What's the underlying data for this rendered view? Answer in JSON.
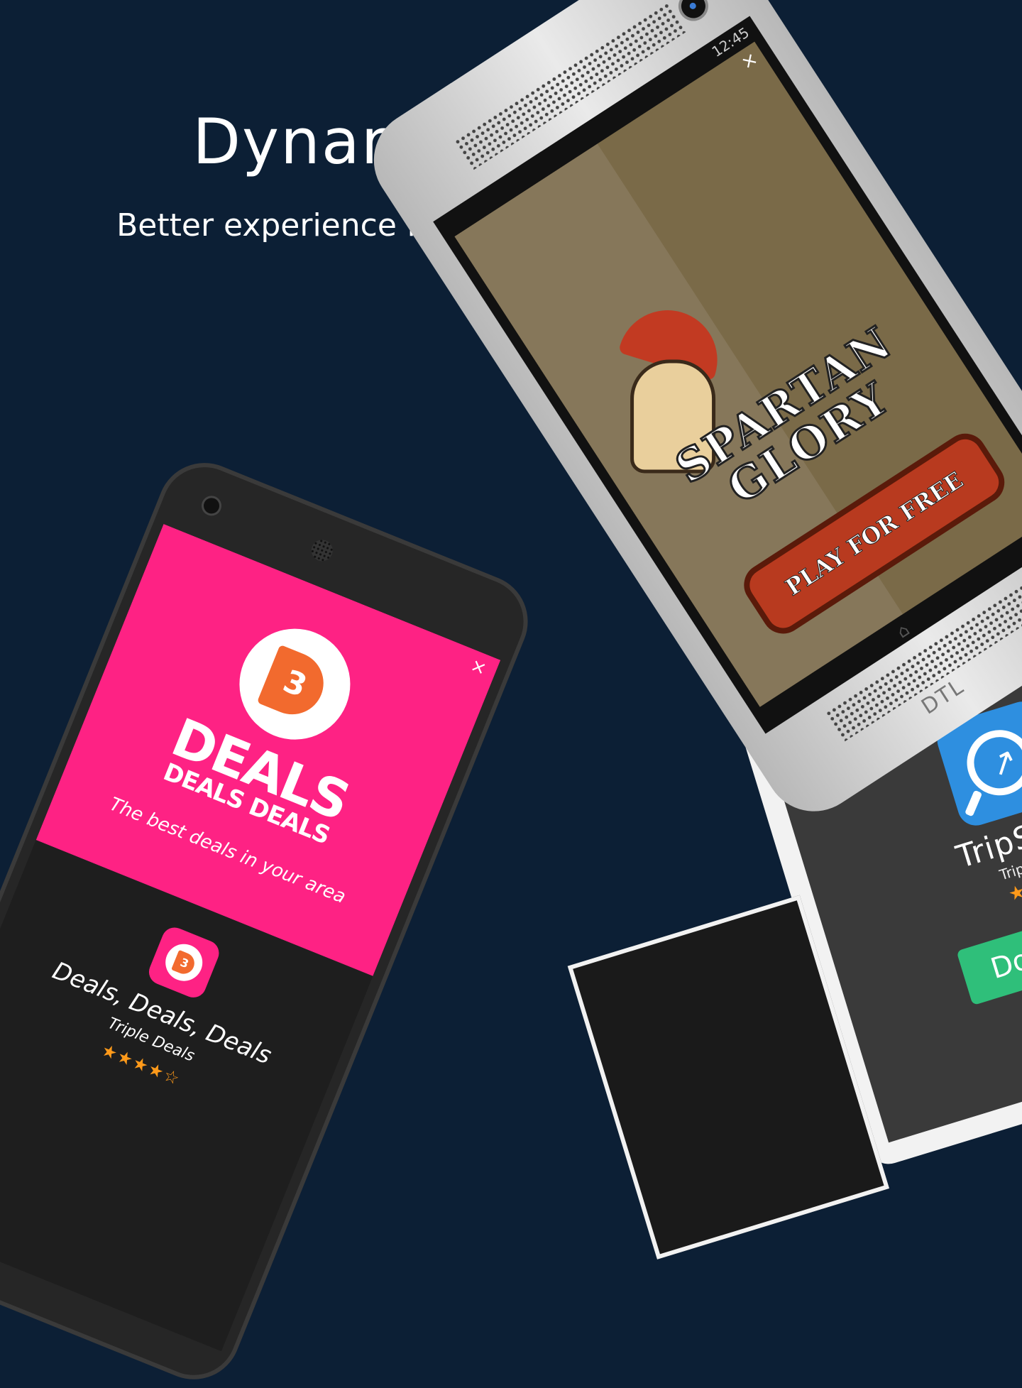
{
  "header": {
    "title": "Dynamic Templates",
    "subtitle": "Better experience for users. Better results for you."
  },
  "tablet_ad": {
    "app_name": "TripSkout",
    "company": "TripSkout, Inc.",
    "stars": "★★★★☆",
    "cta_label": "Download F",
    "icon": "magnifier-arrow-icon",
    "icon_color": "#2e8fe0",
    "cta_color": "#2fbf7a"
  },
  "htc_ad": {
    "status_time": "12:45",
    "close_label": "×",
    "game_title_line1": "SPARTAN",
    "game_title_line2": "GLORY",
    "cta_label": "PLAY FOR FREE",
    "nav_home_icon": "home-icon",
    "brand": "DTL",
    "background_color": "#7a6a48",
    "cta_color": "#b83a1f"
  },
  "nexus_ad": {
    "close_label": "×",
    "badge_letter": "3",
    "headline": "DEALS",
    "subheadline": "DEALS DEALS",
    "tagline": "The best deals in your area",
    "app_name": "Deals, Deals, Deals",
    "company": "Triple Deals",
    "stars": "★★★★☆",
    "brand_color": "#fe2284",
    "badge_color": "#f26a2e"
  }
}
